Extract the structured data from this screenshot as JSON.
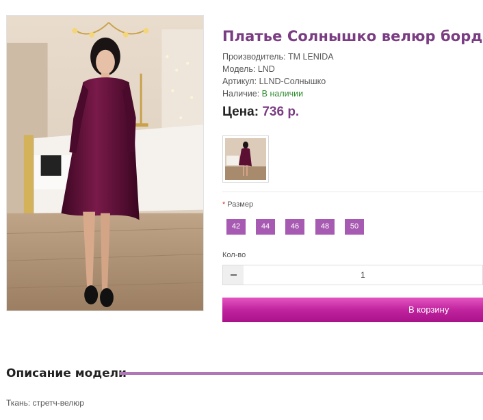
{
  "product": {
    "title": "Платье Солнышко велюр бордо",
    "manufacturer_label": "Производитель:",
    "manufacturer": "TM LENIDA",
    "model_label": "Модель:",
    "model": "LND",
    "sku_label": "Артикул:",
    "sku": "LLND-Солнышко",
    "availability_label": "Наличие:",
    "availability": "В наличии",
    "price_label": "Цена:",
    "price": "736 р."
  },
  "options": {
    "size_required_mark": "*",
    "size_label": "Размер",
    "sizes": [
      "42",
      "44",
      "46",
      "48",
      "50"
    ],
    "qty_label": "Кол-во",
    "qty_value": "1",
    "add_to_cart": "В корзину"
  },
  "description": {
    "heading": "Описание модели",
    "fabric": "Ткань: стретч-велюр"
  },
  "colors": {
    "accent": "#7a3c82",
    "size_button": "#a75ab1",
    "cart_button": "#c0249e",
    "in_stock": "#2e8b2e",
    "dress": "#5a0f33"
  },
  "icons": {
    "qty_decrease": "minus-icon"
  }
}
